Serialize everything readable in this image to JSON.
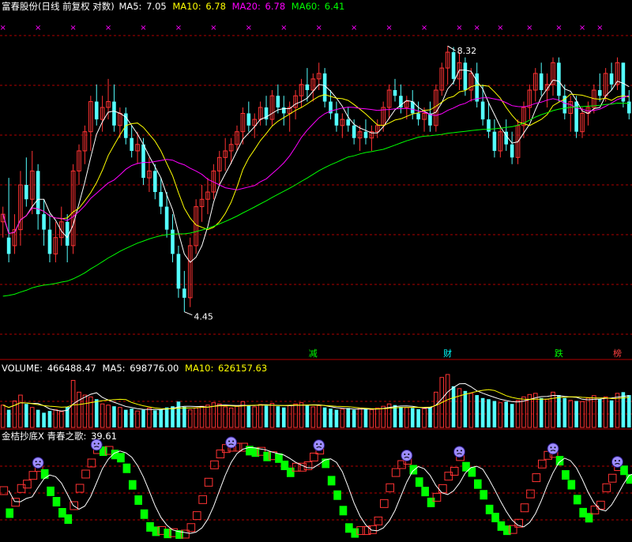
{
  "header": {
    "title": "富春股份(日线 前复权 对数)",
    "ma": [
      {
        "label": "MA5: ",
        "value": "7.05",
        "color": "#ffffff"
      },
      {
        "label": "MA10: ",
        "value": "6.78",
        "color": "#ffff00"
      },
      {
        "label": "MA20: ",
        "value": "6.78",
        "color": "#ff00ff"
      },
      {
        "label": "MA60: ",
        "value": "6.41",
        "color": "#00ff00"
      }
    ]
  },
  "volume_header": {
    "label": "VOLUME: ",
    "value": "466488.47",
    "ma5_label": "MA5: ",
    "ma5_value": "698776.00",
    "ma10_label": "MA10: ",
    "ma10_value": "626157.63"
  },
  "indicator_header": {
    "name": "金桔抄底X 青春之歌: ",
    "value": "39.61"
  },
  "annotations": {
    "high": "8.32",
    "low": "4.45",
    "signals": [
      {
        "text": "减",
        "color": "#00ff00"
      },
      {
        "text": "财",
        "color": "#00ffff"
      },
      {
        "text": "跌",
        "color": "#00ff00"
      },
      {
        "text": "榜",
        "color": "#ff4040"
      }
    ],
    "marker_glyph": "×"
  },
  "colors": {
    "up": "#ff3333",
    "down": "#54ffff",
    "grid": "#b00000",
    "ma5": "#ffffff",
    "ma10": "#ffff00",
    "ma20": "#ff00ff",
    "ma60": "#00ff00",
    "osc_line": "#ffffff",
    "osc_up": "#ff3333",
    "osc_down": "#00ff00",
    "marker": "#ff00ff",
    "face": "#9d8cff"
  },
  "chart_data": {
    "type": "candlestick",
    "scale": "log",
    "price_range": [
      4.0,
      9.0
    ],
    "candles": [
      [
        5.5,
        5.7,
        5.3,
        5.6
      ],
      [
        5.3,
        6.1,
        5.0,
        5.1
      ],
      [
        5.2,
        5.6,
        5.1,
        5.4
      ],
      [
        5.4,
        6.2,
        5.2,
        6.0
      ],
      [
        6.0,
        6.4,
        5.7,
        5.8
      ],
      [
        5.8,
        6.5,
        5.6,
        6.2
      ],
      [
        6.2,
        6.3,
        5.4,
        5.6
      ],
      [
        5.6,
        5.8,
        5.2,
        5.4
      ],
      [
        5.4,
        5.6,
        5.0,
        5.1
      ],
      [
        5.1,
        5.5,
        5.0,
        5.3
      ],
      [
        5.3,
        5.7,
        5.2,
        5.5
      ],
      [
        5.5,
        5.6,
        5.0,
        5.2
      ],
      [
        5.2,
        6.3,
        5.1,
        6.2
      ],
      [
        6.2,
        6.6,
        6.0,
        6.5
      ],
      [
        6.5,
        6.9,
        6.3,
        6.8
      ],
      [
        6.8,
        7.4,
        6.5,
        7.3
      ],
      [
        7.3,
        7.6,
        6.9,
        7.0
      ],
      [
        7.0,
        7.4,
        6.8,
        7.2
      ],
      [
        7.2,
        7.7,
        7.0,
        7.3
      ],
      [
        7.3,
        7.6,
        6.8,
        6.9
      ],
      [
        6.9,
        7.2,
        6.7,
        7.1
      ],
      [
        7.1,
        7.2,
        6.6,
        6.7
      ],
      [
        6.7,
        6.9,
        6.4,
        6.5
      ],
      [
        6.5,
        6.8,
        6.3,
        6.6
      ],
      [
        6.6,
        6.7,
        6.0,
        6.1
      ],
      [
        6.1,
        6.4,
        5.9,
        6.2
      ],
      [
        6.2,
        6.3,
        5.8,
        5.9
      ],
      [
        5.9,
        6.1,
        5.6,
        5.7
      ],
      [
        5.7,
        5.9,
        5.3,
        5.4
      ],
      [
        5.4,
        5.6,
        5.0,
        5.1
      ],
      [
        5.1,
        5.2,
        4.6,
        4.7
      ],
      [
        4.7,
        4.9,
        4.45,
        4.6
      ],
      [
        4.6,
        5.3,
        4.5,
        5.2
      ],
      [
        5.2,
        5.8,
        5.1,
        5.7
      ],
      [
        5.7,
        6.0,
        5.5,
        5.8
      ],
      [
        5.8,
        6.1,
        5.6,
        5.9
      ],
      [
        5.9,
        6.3,
        5.8,
        6.2
      ],
      [
        6.2,
        6.5,
        6.0,
        6.4
      ],
      [
        6.4,
        6.7,
        6.2,
        6.5
      ],
      [
        6.5,
        6.7,
        6.3,
        6.6
      ],
      [
        6.6,
        6.9,
        6.5,
        6.8
      ],
      [
        6.8,
        7.2,
        6.6,
        7.1
      ],
      [
        7.1,
        7.3,
        6.8,
        6.9
      ],
      [
        6.9,
        7.1,
        6.7,
        7.0
      ],
      [
        7.0,
        7.3,
        6.9,
        7.2
      ],
      [
        7.2,
        7.4,
        6.9,
        7.0
      ],
      [
        7.0,
        7.5,
        6.9,
        7.4
      ],
      [
        7.4,
        7.6,
        7.1,
        7.2
      ],
      [
        7.2,
        7.4,
        6.9,
        7.1
      ],
      [
        7.1,
        7.3,
        6.8,
        7.2
      ],
      [
        7.2,
        7.5,
        7.0,
        7.4
      ],
      [
        7.4,
        7.7,
        7.2,
        7.6
      ],
      [
        7.6,
        7.9,
        7.3,
        7.5
      ],
      [
        7.5,
        7.8,
        7.3,
        7.7
      ],
      [
        7.7,
        8.0,
        7.5,
        7.8
      ],
      [
        7.8,
        7.9,
        7.2,
        7.3
      ],
      [
        7.3,
        7.5,
        7.0,
        7.1
      ],
      [
        7.1,
        7.3,
        6.8,
        6.9
      ],
      [
        6.9,
        7.1,
        6.7,
        7.0
      ],
      [
        7.0,
        7.2,
        6.8,
        6.9
      ],
      [
        6.9,
        7.0,
        6.6,
        6.7
      ],
      [
        6.7,
        6.9,
        6.5,
        6.8
      ],
      [
        6.8,
        7.0,
        6.6,
        6.7
      ],
      [
        6.7,
        6.9,
        6.5,
        6.8
      ],
      [
        6.8,
        7.0,
        6.7,
        6.9
      ],
      [
        6.9,
        7.3,
        6.8,
        7.2
      ],
      [
        7.2,
        7.6,
        7.0,
        7.5
      ],
      [
        7.5,
        7.7,
        7.3,
        7.4
      ],
      [
        7.4,
        7.6,
        7.1,
        7.2
      ],
      [
        7.2,
        7.4,
        7.0,
        7.3
      ],
      [
        7.3,
        7.5,
        7.0,
        7.1
      ],
      [
        7.1,
        7.3,
        6.9,
        7.0
      ],
      [
        7.0,
        7.2,
        6.8,
        7.1
      ],
      [
        7.1,
        7.3,
        6.8,
        6.9
      ],
      [
        6.9,
        7.6,
        6.8,
        7.5
      ],
      [
        7.5,
        8.0,
        7.4,
        7.9
      ],
      [
        7.9,
        8.32,
        7.6,
        8.2
      ],
      [
        8.2,
        8.3,
        7.6,
        7.7
      ],
      [
        7.7,
        8.2,
        7.5,
        8.0
      ],
      [
        8.0,
        8.1,
        7.4,
        7.5
      ],
      [
        7.5,
        7.9,
        7.3,
        7.8
      ],
      [
        7.8,
        8.0,
        7.2,
        7.3
      ],
      [
        7.3,
        7.6,
        6.9,
        7.0
      ],
      [
        7.0,
        7.3,
        6.7,
        6.8
      ],
      [
        6.8,
        7.0,
        6.4,
        6.5
      ],
      [
        6.5,
        6.9,
        6.4,
        6.8
      ],
      [
        6.8,
        7.0,
        6.5,
        6.6
      ],
      [
        6.6,
        6.8,
        6.3,
        6.4
      ],
      [
        6.4,
        7.0,
        6.3,
        6.9
      ],
      [
        6.9,
        7.3,
        6.7,
        7.2
      ],
      [
        7.2,
        7.6,
        7.0,
        7.5
      ],
      [
        7.5,
        7.9,
        7.3,
        7.8
      ],
      [
        7.8,
        8.0,
        7.4,
        7.5
      ],
      [
        7.5,
        7.8,
        7.2,
        7.6
      ],
      [
        7.6,
        8.1,
        7.4,
        8.0
      ],
      [
        8.0,
        8.1,
        7.3,
        7.4
      ],
      [
        7.4,
        7.6,
        7.0,
        7.1
      ],
      [
        7.1,
        7.4,
        6.8,
        7.3
      ],
      [
        7.3,
        7.4,
        6.7,
        6.8
      ],
      [
        6.8,
        7.2,
        6.7,
        7.1
      ],
      [
        7.1,
        7.3,
        6.9,
        7.2
      ],
      [
        7.2,
        7.6,
        7.1,
        7.5
      ],
      [
        7.5,
        7.8,
        7.3,
        7.4
      ],
      [
        7.4,
        7.9,
        7.3,
        7.8
      ],
      [
        7.8,
        8.0,
        7.5,
        7.6
      ],
      [
        7.6,
        8.1,
        7.5,
        8.0
      ],
      [
        8.0,
        8.0,
        7.2,
        7.3
      ],
      [
        7.3,
        7.5,
        7.0,
        7.1
      ]
    ],
    "ma_series": [
      "MA5",
      "MA10",
      "MA20",
      "MA60"
    ],
    "volume": [
      38,
      30,
      45,
      55,
      40,
      34,
      30,
      25,
      28,
      30,
      27,
      35,
      80,
      60,
      55,
      52,
      48,
      40,
      38,
      36,
      34,
      30,
      32,
      28,
      30,
      33,
      29,
      31,
      34,
      36,
      44,
      35,
      30,
      33,
      36,
      38,
      42,
      40,
      35,
      33,
      36,
      44,
      38,
      35,
      39,
      37,
      41,
      36,
      34,
      37,
      40,
      42,
      38,
      35,
      37,
      34,
      32,
      30,
      31,
      33,
      30,
      32,
      31,
      30,
      33,
      36,
      40,
      38,
      35,
      34,
      33,
      31,
      32,
      35,
      60,
      85,
      90,
      70,
      66,
      62,
      58,
      55,
      50,
      48,
      45,
      42,
      44,
      40,
      46,
      52,
      56,
      58,
      50,
      48,
      60,
      55,
      50,
      46,
      45,
      44,
      50,
      54,
      48,
      52,
      46,
      58,
      60,
      55
    ]
  }
}
